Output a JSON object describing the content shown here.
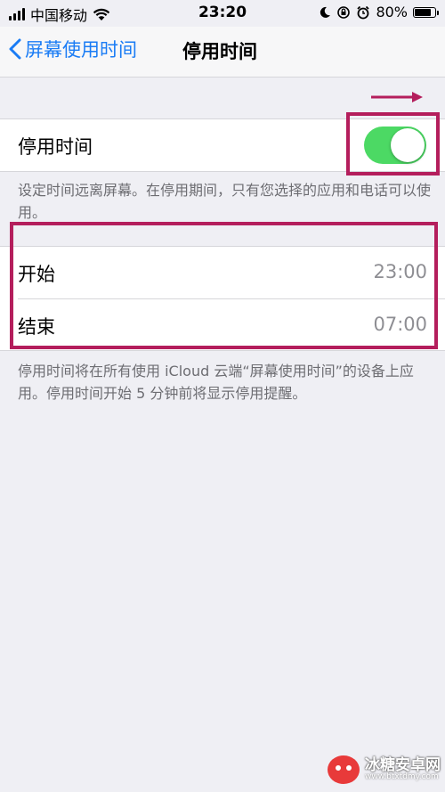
{
  "status_bar": {
    "carrier": "中国移动",
    "time": "23:20",
    "battery_percent": "80%",
    "battery_level": 0.8
  },
  "nav": {
    "back_label": "屏幕使用时间",
    "title": "停用时间"
  },
  "downtime_toggle": {
    "label": "停用时间",
    "on": true,
    "footer": "设定时间远离屏幕。在停用期间，只有您选择的应用和电话可以使用。"
  },
  "schedule": {
    "rows": [
      {
        "label": "开始",
        "value": "23:00"
      },
      {
        "label": "结束",
        "value": "07:00"
      }
    ],
    "footer": "停用时间将在所有使用 iCloud 云端“屏幕使用时间”的设备上应用。停用时间开始 5 分钟前将显示停用提醒。"
  },
  "watermark": {
    "name": "冰糖安卓网",
    "url": "www.btxtdmy.com"
  },
  "colors": {
    "accent": "#1a7cf5",
    "toggle_on": "#4cd964",
    "annotation": "#b41e5c"
  }
}
